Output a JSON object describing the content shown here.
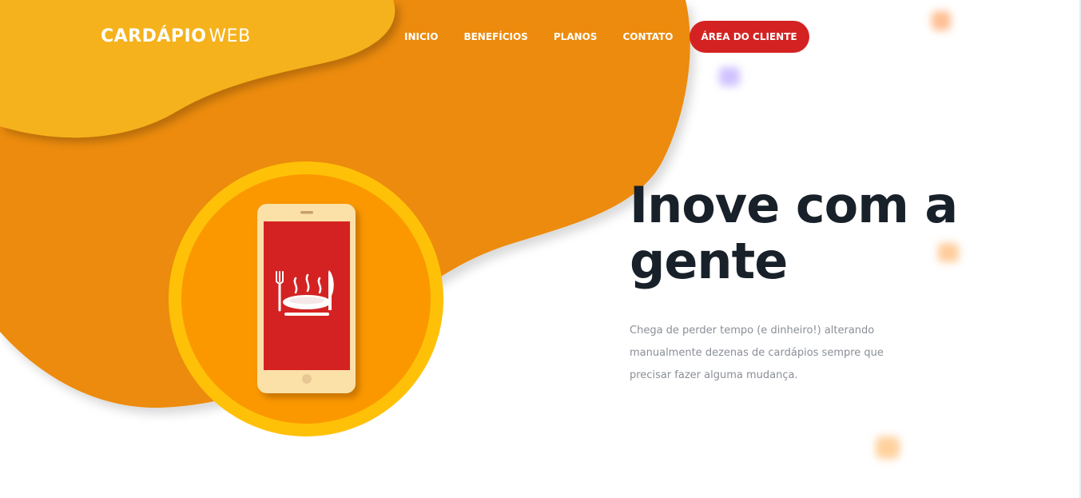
{
  "brand": {
    "strong": "CARDÁPIO",
    "light": "WEB"
  },
  "nav": {
    "items": [
      "INICIO",
      "BENEFÍCIOS",
      "PLANOS",
      "CONTATO"
    ],
    "cta": "ÁREA DO CLIENTE"
  },
  "hero": {
    "title": "Inove com a gente",
    "description": "Chega de perder tempo (e dinheiro!) alterando manualmente dezenas de cardápios sempre que precisar fazer alguma mudança."
  },
  "colors": {
    "blob_yellow": "#f5b21a",
    "blob_orange": "#ec8b10",
    "cta_red": "#d42222",
    "title_dark": "#18212a",
    "text_gray": "#8a8f96",
    "badge_outer": "#ffc107",
    "badge_inner": "#fb9800",
    "phone_body": "#fbe0a8",
    "phone_screen": "#d42222"
  },
  "icons": [
    "phone-icon",
    "fork-icon",
    "knife-icon",
    "plate-icon",
    "steam-icon"
  ]
}
